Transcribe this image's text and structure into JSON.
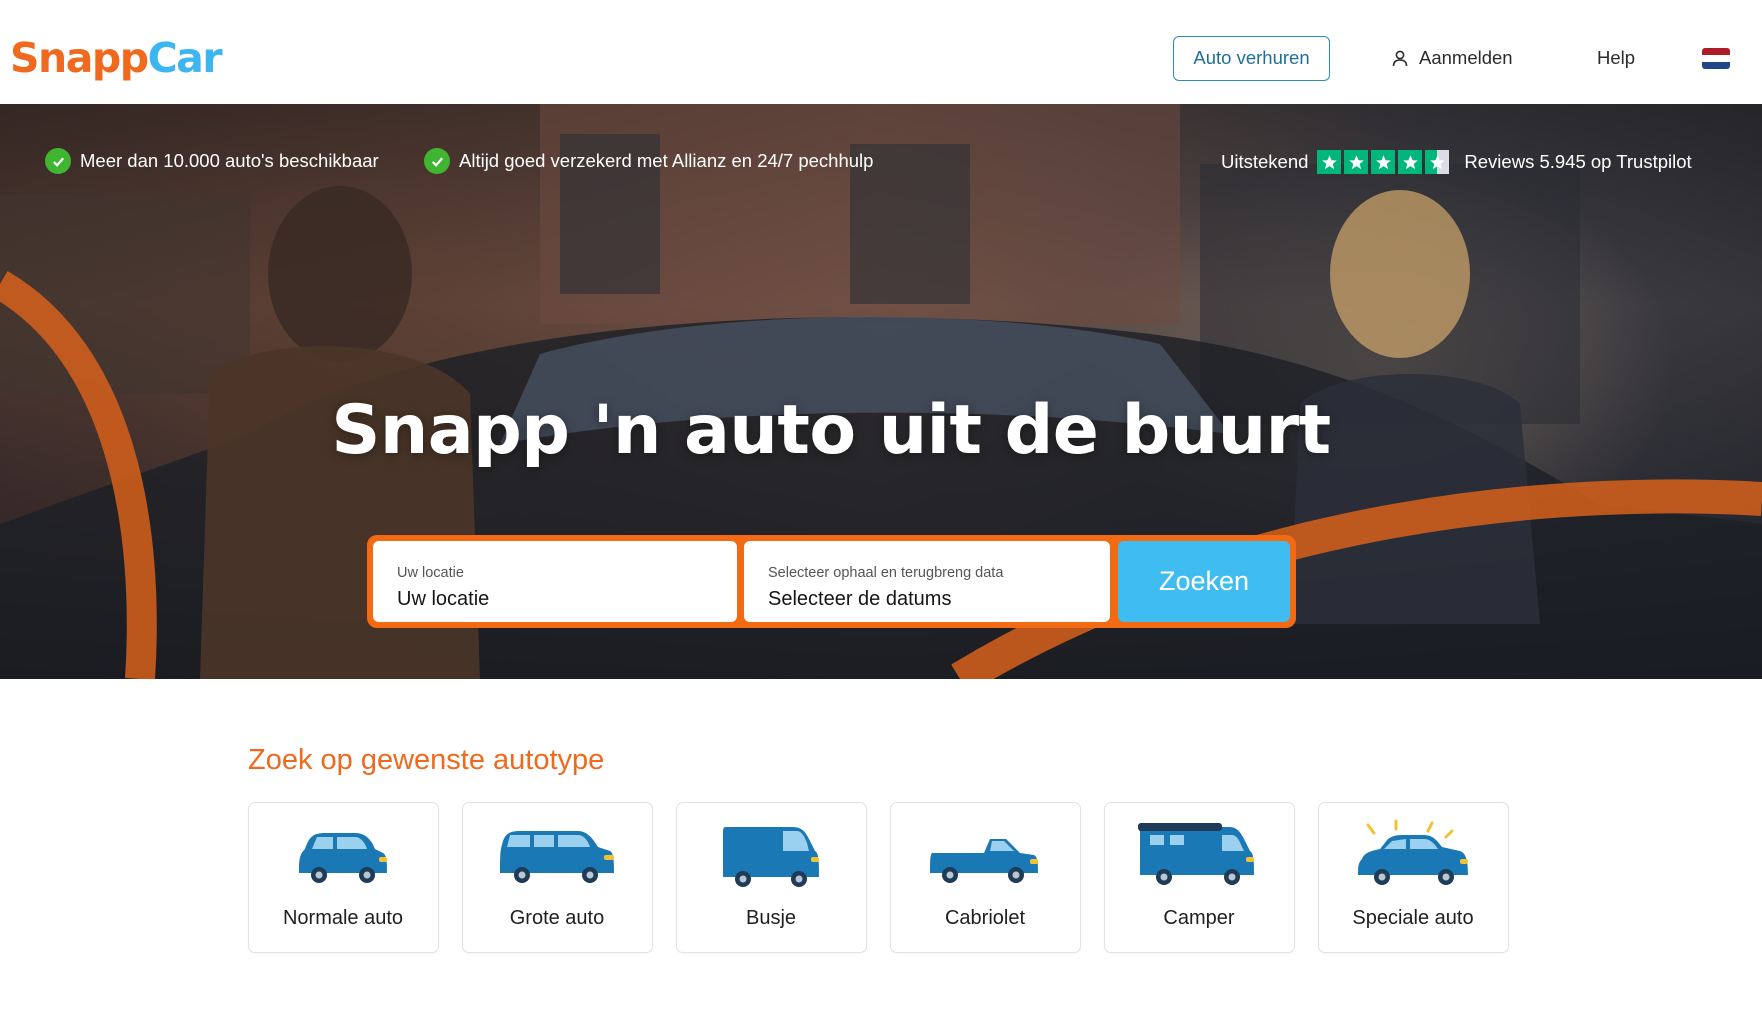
{
  "header": {
    "logo": {
      "part1": "Snapp",
      "part2": "Car"
    },
    "rent_button": "Auto verhuren",
    "login": "Aanmelden",
    "help": "Help",
    "language_flag": "netherlands-flag"
  },
  "hero": {
    "usps": [
      "Meer dan 10.000 auto's beschikbaar",
      "Altijd goed verzekerd met Allianz en 24/7 pechhulp"
    ],
    "trustpilot": {
      "rating_label": "Uitstekend",
      "stars_filled": 4.5,
      "stars_total": 5,
      "reviews_text": "Reviews 5.945 op Trustpilot"
    },
    "title": "Snapp 'n auto uit de buurt",
    "search": {
      "location_label": "Uw locatie",
      "location_value": "Uw locatie",
      "dates_label": "Selecteer ophaal en terugbreng data",
      "dates_value": "Selecteer de datums",
      "button": "Zoeken"
    }
  },
  "car_types": {
    "title": "Zoek op gewenste autotype",
    "items": [
      {
        "label": "Normale auto",
        "icon": "small-car-icon"
      },
      {
        "label": "Grote auto",
        "icon": "station-wagon-icon"
      },
      {
        "label": "Busje",
        "icon": "van-icon"
      },
      {
        "label": "Cabriolet",
        "icon": "convertible-icon"
      },
      {
        "label": "Camper",
        "icon": "camper-icon"
      },
      {
        "label": "Speciale auto",
        "icon": "special-car-icon"
      }
    ]
  },
  "colors": {
    "brand_orange": "#ef6a1f",
    "brand_blue": "#3db5f0",
    "search_button": "#3fbdf1",
    "trustpilot_green": "#00b67a",
    "check_green": "#3fb531",
    "car_icon_blue": "#1a78b5"
  }
}
